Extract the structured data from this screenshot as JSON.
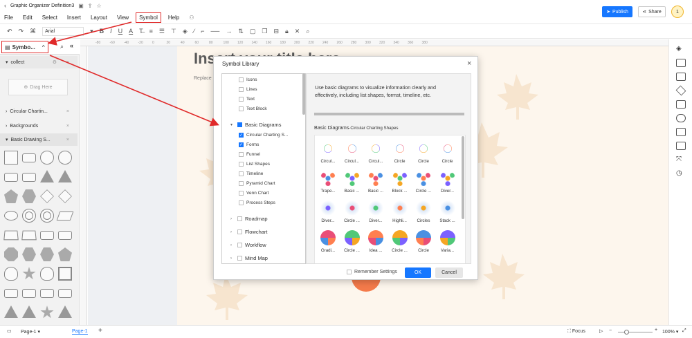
{
  "app": {
    "doc_title": "Graphic Organizer Definition3",
    "publish_label": "Publish",
    "share_label": "Share",
    "avatar_label": "1"
  },
  "menu": [
    "File",
    "Edit",
    "Select",
    "Insert",
    "Layout",
    "View",
    "Symbol",
    "Help"
  ],
  "toolbar": {
    "font": "Arial",
    "bold": "B",
    "italic": "I",
    "underline": "U",
    "fontcolor": "A"
  },
  "left_panel": {
    "title": "Symbo...",
    "collect": "collect",
    "drag_here": "Drag Here",
    "libraries": [
      "Circular Chartin...",
      "Backgrounds",
      "Basic Drawing S..."
    ]
  },
  "canvas": {
    "title": "Insert your title here",
    "subtitle": "Replace"
  },
  "ruler_ticks": [
    "-80",
    "-60",
    "-40",
    "-20",
    "0",
    "20",
    "40",
    "60",
    "80",
    "100",
    "120",
    "140",
    "160",
    "180",
    "200",
    "220",
    "240",
    "260",
    "280",
    "300",
    "320",
    "340",
    "360",
    "380"
  ],
  "dialog": {
    "title": "Symbol Library",
    "tree_top": [
      "Icons",
      "Lines",
      "Text",
      "Text Block"
    ],
    "tree_group": "Basic Diagrams",
    "tree_children": [
      {
        "label": "Circular Charting S...",
        "checked": true
      },
      {
        "label": "Forms",
        "checked": true
      },
      {
        "label": "Funnel",
        "checked": false
      },
      {
        "label": "List Shapes",
        "checked": false
      },
      {
        "label": "Timeline",
        "checked": false
      },
      {
        "label": "Pyramid Chart",
        "checked": false
      },
      {
        "label": "Venn Chart",
        "checked": false
      },
      {
        "label": "Process Steps",
        "checked": false
      }
    ],
    "tree_groups": [
      "Roadmap",
      "Flowchart",
      "Workflow",
      "Mind Map"
    ],
    "description": "Use basic diagrams to visualize information clearly and effectively, including list shapes, formst, timeline, etc.",
    "section_main": "Basic Diagrams",
    "section_sub": "-Circular Charting Shapes",
    "symbols": [
      [
        "Circul...",
        "Circul...",
        "Circul...",
        "Circle",
        "Circle",
        "Circle"
      ],
      [
        "Trape...",
        "Basic ...",
        "Basic ...",
        "Block ...",
        "Circle ...",
        "Diver..."
      ],
      [
        "Diver...",
        "Circle ...",
        "Diver...",
        "Highli...",
        "Circles",
        "Stack ..."
      ],
      [
        "Gradi...",
        "Circle ...",
        "Idea ...",
        "Circle ...",
        "Circle",
        "Varia..."
      ]
    ],
    "remember": "Remember Settings",
    "ok": "OK",
    "cancel": "Cancel"
  },
  "status": {
    "page_tab": "Page-1",
    "page_active": "Page-1",
    "focus": "Focus",
    "zoom": "100%"
  },
  "colors": {
    "accent": "#1677ff",
    "highlight": "#e02a2a",
    "icon_palette": [
      "#f5a623",
      "#4a90e2",
      "#7b61ff",
      "#e94e77",
      "#50c878",
      "#ff7f50"
    ]
  }
}
